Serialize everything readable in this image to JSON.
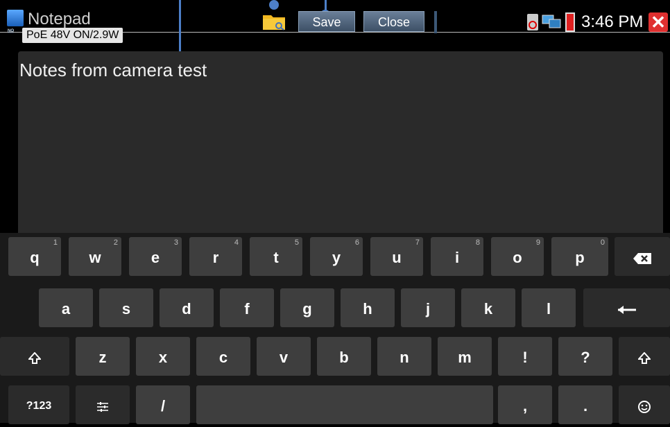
{
  "app": {
    "title": "Notepad",
    "poe_status": "PoE 48V ON/2.9W"
  },
  "toolbar": {
    "save_label": "Save",
    "close_label": "Close"
  },
  "status": {
    "time": "3:46 PM"
  },
  "editor": {
    "text": "Notes from camera test"
  },
  "keyboard": {
    "row1": [
      {
        "label": "q",
        "hint": "1"
      },
      {
        "label": "w",
        "hint": "2"
      },
      {
        "label": "e",
        "hint": "3"
      },
      {
        "label": "r",
        "hint": "4"
      },
      {
        "label": "t",
        "hint": "5"
      },
      {
        "label": "y",
        "hint": "6"
      },
      {
        "label": "u",
        "hint": "7"
      },
      {
        "label": "i",
        "hint": "8"
      },
      {
        "label": "o",
        "hint": "9"
      },
      {
        "label": "p",
        "hint": "0"
      }
    ],
    "row2": [
      "a",
      "s",
      "d",
      "f",
      "g",
      "h",
      "j",
      "k",
      "l"
    ],
    "row3": [
      "z",
      "x",
      "c",
      "v",
      "b",
      "n",
      "m",
      "!",
      "?"
    ],
    "row4": {
      "sym": "?123",
      "slash": "/",
      "comma": ",",
      "period": "."
    },
    "icons": {
      "backspace": "backspace-icon",
      "enter": "enter-icon",
      "shift": "shift-icon",
      "settings": "keyboard-settings-icon",
      "emoji": "emoji-icon"
    }
  },
  "colors": {
    "accent_blue": "#4d7fc8",
    "button_blue": "#4a6079",
    "exit_red": "#e03030"
  }
}
